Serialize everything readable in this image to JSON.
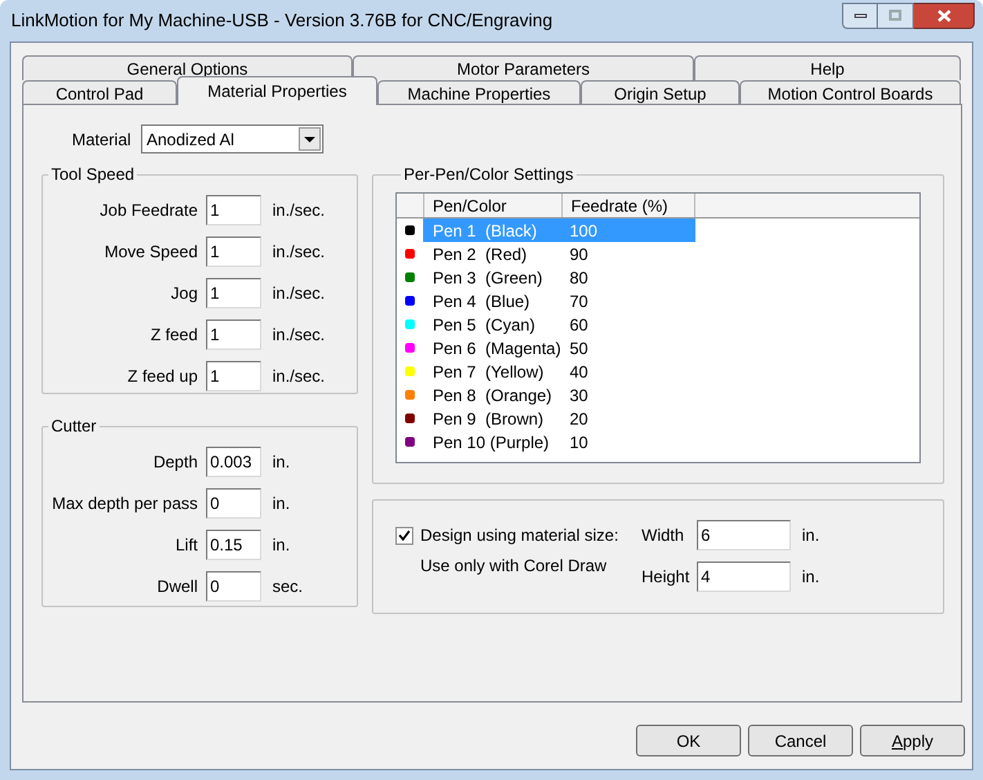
{
  "window": {
    "title": "LinkMotion for My Machine-USB - Version 3.76B for CNC/Engraving"
  },
  "tabs": [
    [
      {
        "label": "General Options",
        "selected": false
      },
      {
        "label": "Motor Parameters",
        "selected": false
      },
      {
        "label": "Help",
        "selected": false
      }
    ],
    [
      {
        "label": "Control Pad",
        "selected": false
      },
      {
        "label": "Material Properties",
        "selected": true
      },
      {
        "label": "Machine Properties",
        "selected": false
      },
      {
        "label": "Origin Setup",
        "selected": false
      },
      {
        "label": "Motion Control Boards",
        "selected": false
      }
    ]
  ],
  "material": {
    "label": "Material",
    "value": "Anodized Al"
  },
  "tool_speed": {
    "title": "Tool Speed",
    "fields": [
      {
        "label": "Job Feedrate",
        "value": "1",
        "unit": "in./sec."
      },
      {
        "label": "Move Speed",
        "value": "1",
        "unit": "in./sec."
      },
      {
        "label": "Jog",
        "value": "1",
        "unit": "in./sec."
      },
      {
        "label": "Z feed",
        "value": "1",
        "unit": "in./sec."
      },
      {
        "label": "Z feed up",
        "value": "1",
        "unit": "in./sec."
      }
    ]
  },
  "cutter": {
    "title": "Cutter",
    "fields": [
      {
        "label": "Depth",
        "value": "0.003",
        "unit": "in."
      },
      {
        "label": "Max depth per pass",
        "value": "0",
        "unit": "in."
      },
      {
        "label": "Lift",
        "value": "0.15",
        "unit": "in."
      },
      {
        "label": "Dwell",
        "value": "0",
        "unit": "sec."
      }
    ]
  },
  "pens": {
    "title": "Per-Pen/Color Settings",
    "columns": [
      "Pen/Color",
      "Feedrate (%)"
    ],
    "rows": [
      {
        "pen": "Pen 1  (Black)",
        "feedrate": "100",
        "color": "#000000",
        "selected": true
      },
      {
        "pen": "Pen 2  (Red)",
        "feedrate": "90",
        "color": "#ff0000",
        "selected": false
      },
      {
        "pen": "Pen 3  (Green)",
        "feedrate": "80",
        "color": "#008000",
        "selected": false
      },
      {
        "pen": "Pen 4  (Blue)",
        "feedrate": "70",
        "color": "#0000ff",
        "selected": false
      },
      {
        "pen": "Pen 5  (Cyan)",
        "feedrate": "60",
        "color": "#00ffff",
        "selected": false
      },
      {
        "pen": "Pen 6  (Magenta)",
        "feedrate": "50",
        "color": "#ff00ff",
        "selected": false
      },
      {
        "pen": "Pen 7  (Yellow)",
        "feedrate": "40",
        "color": "#ffff00",
        "selected": false
      },
      {
        "pen": "Pen 8  (Orange)",
        "feedrate": "30",
        "color": "#ff8000",
        "selected": false
      },
      {
        "pen": "Pen 9  (Brown)",
        "feedrate": "20",
        "color": "#800000",
        "selected": false
      },
      {
        "pen": "Pen 10 (Purple)",
        "feedrate": "10",
        "color": "#800080",
        "selected": false
      }
    ]
  },
  "design_size": {
    "label": "Design using material size:",
    "checked": true,
    "note": "Use only with Corel Draw",
    "fields": [
      {
        "label": "Width",
        "value": "6",
        "unit": "in."
      },
      {
        "label": "Height",
        "value": "4",
        "unit": "in."
      }
    ]
  },
  "buttons": [
    {
      "label": "OK",
      "first_letter_underlined": false
    },
    {
      "label": "Cancel",
      "first_letter_underlined": false
    },
    {
      "label": "Apply",
      "first_letter_underlined": true
    }
  ]
}
